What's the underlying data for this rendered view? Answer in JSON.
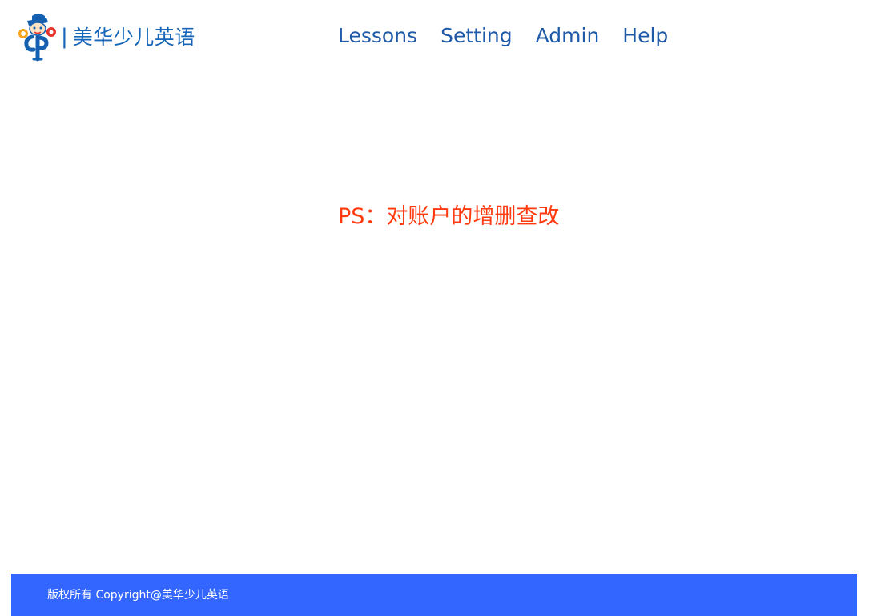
{
  "header": {
    "separator": "|",
    "brand_name": "美华少儿英语",
    "logo_icon": "boy-character-logo-icon",
    "nav": [
      {
        "label": "Lessons"
      },
      {
        "label": "Setting"
      },
      {
        "label": "Admin"
      },
      {
        "label": "Help"
      }
    ]
  },
  "main": {
    "notice": "PS：对账户的增删查改"
  },
  "footer": {
    "copyright": "版权所有 Copyright@美华少儿英语"
  },
  "colors": {
    "brand": "#1565b8",
    "nav": "#1f5aa8",
    "notice": "#ff3a0f",
    "footer_bg": "#3366ff",
    "footer_text": "#ffffff"
  }
}
